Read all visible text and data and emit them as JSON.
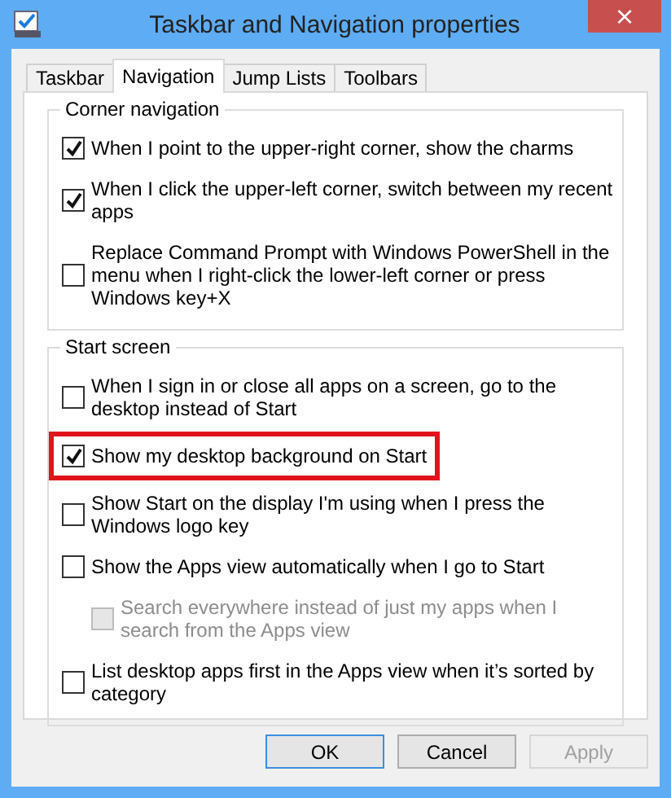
{
  "window": {
    "title": "Taskbar and Navigation properties",
    "close": "×"
  },
  "tabs": [
    {
      "label": "Taskbar",
      "selected": false
    },
    {
      "label": "Navigation",
      "selected": true
    },
    {
      "label": "Jump Lists",
      "selected": false
    },
    {
      "label": "Toolbars",
      "selected": false
    }
  ],
  "groups": [
    {
      "title": "Corner navigation",
      "options": [
        {
          "label": "When I point to the upper-right corner, show the charms",
          "checked": true,
          "disabled": false,
          "highlighted": false
        },
        {
          "label": "When I click the upper-left corner, switch between my recent apps",
          "checked": true,
          "disabled": false,
          "highlighted": false
        },
        {
          "label": "Replace Command Prompt with Windows PowerShell in the menu when I right-click the lower-left corner or press Windows key+X",
          "checked": false,
          "disabled": false,
          "highlighted": false
        }
      ]
    },
    {
      "title": "Start screen",
      "options": [
        {
          "label": "When I sign in or close all apps on a screen, go to the desktop instead of Start",
          "checked": false,
          "disabled": false,
          "highlighted": false
        },
        {
          "label": "Show my desktop background on Start",
          "checked": true,
          "disabled": false,
          "highlighted": true
        },
        {
          "label": "Show Start on the display I'm using when I press the Windows logo key",
          "checked": false,
          "disabled": false,
          "highlighted": false
        },
        {
          "label": "Show the Apps view automatically when I go to Start",
          "checked": false,
          "disabled": false,
          "highlighted": false,
          "children": [
            {
              "label": "Search everywhere instead of just my apps when I search from the Apps view",
              "checked": false,
              "disabled": true,
              "highlighted": false
            }
          ]
        },
        {
          "label": "List desktop apps first in the Apps view when it’s sorted by category",
          "checked": false,
          "disabled": false,
          "highlighted": false
        }
      ]
    }
  ],
  "buttons": [
    {
      "label": "OK",
      "kind": "default",
      "disabled": false
    },
    {
      "label": "Cancel",
      "kind": "normal",
      "disabled": false
    },
    {
      "label": "Apply",
      "kind": "normal",
      "disabled": true
    }
  ]
}
